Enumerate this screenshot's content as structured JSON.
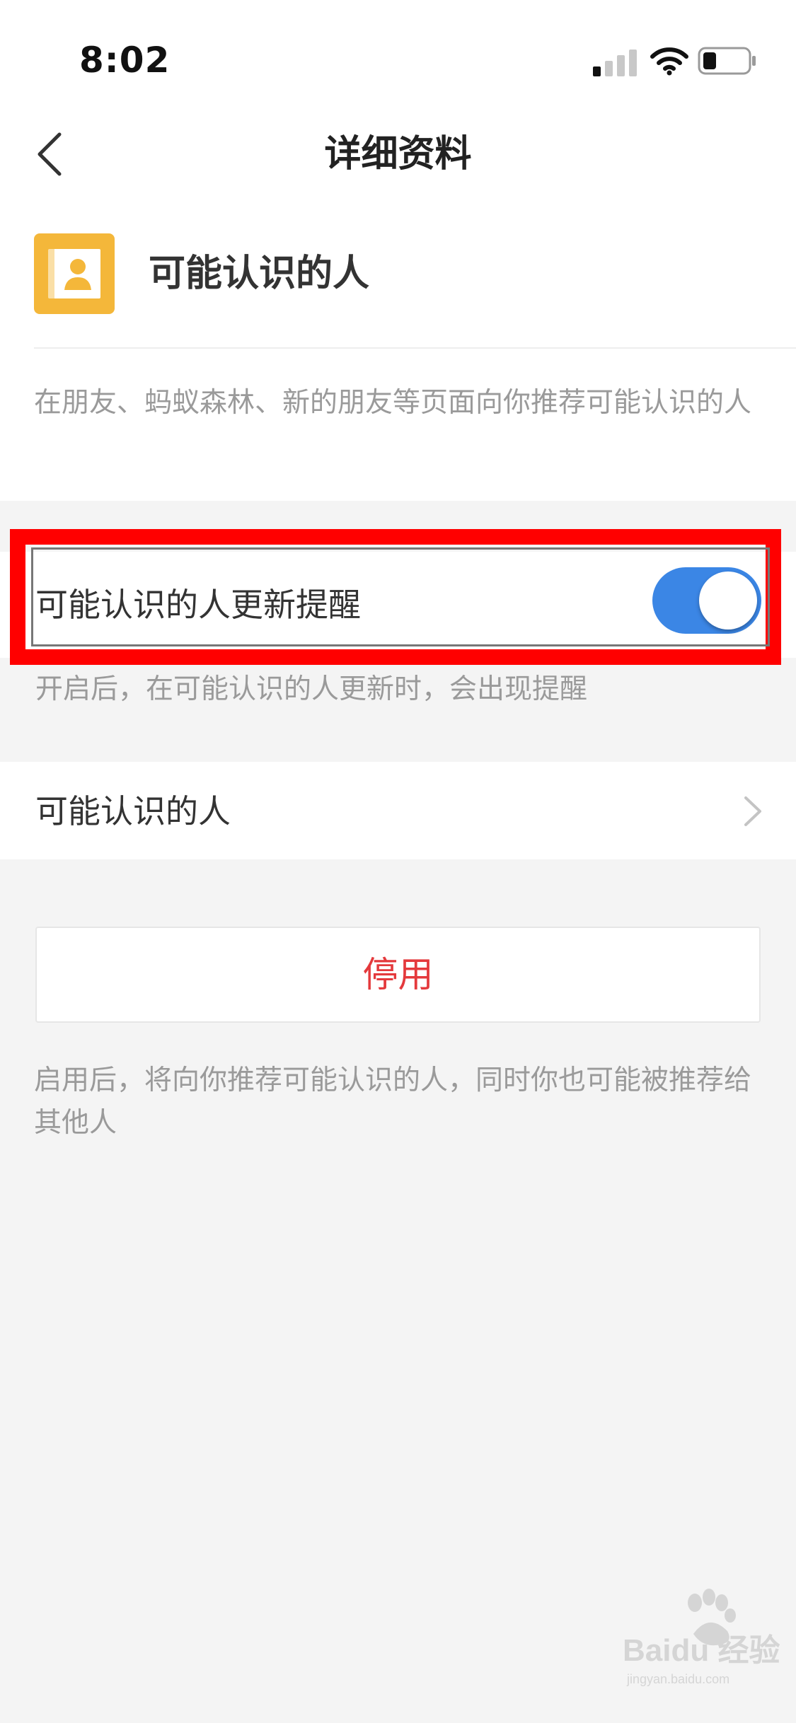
{
  "status_bar": {
    "time": "8:02"
  },
  "nav": {
    "title": "详细资料"
  },
  "app": {
    "name": "可能认识的人",
    "description": "在朋友、蚂蚁森林、新的朋友等页面向你推荐可能认识的人",
    "accent_color": "#f4b73a"
  },
  "toggle": {
    "label": "可能认识的人更新提醒",
    "enabled": true,
    "hint": "开启后，在可能认识的人更新时，会出现提醒",
    "on_color": "#3b86e5"
  },
  "link_row": {
    "label": "可能认识的人"
  },
  "disable_button": {
    "label": "停用",
    "color": "#e4393c"
  },
  "disable_hint": "启用后，将向你推荐可能认识的人，同时你也可能被推荐给其他人",
  "watermark": {
    "text": "Baidu 经验",
    "subtext": "jingyan.baidu.com"
  },
  "icons": {
    "back": "chevron-left-icon",
    "app": "contacts-book-icon",
    "row_arrow": "chevron-right-icon",
    "signal": "cellular-signal-icon",
    "wifi": "wifi-icon",
    "battery": "battery-icon"
  }
}
